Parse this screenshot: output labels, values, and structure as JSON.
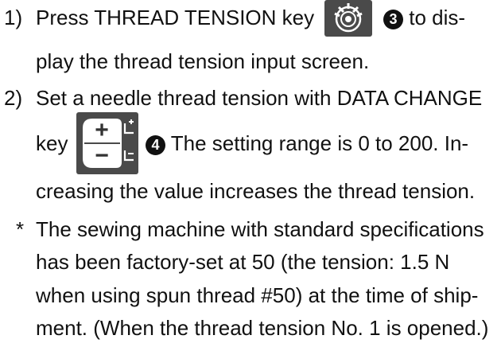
{
  "step1": {
    "number": "1)",
    "before_key": "Press THREAD TENSION key",
    "marker": "3",
    "after_key": " to dis-",
    "continuation": "play the thread tension input screen."
  },
  "step2": {
    "number": "2)",
    "line1": "Set a needle thread tension with DATA CHANGE",
    "before_key": "key",
    "marker": "4",
    "after_key": " The setting range is 0 to 200. In-",
    "continuation": "creasing the value increases the thread tension."
  },
  "note": {
    "asterisk": "*",
    "lines": [
      "The sewing machine with standard specifications",
      "has been factory-set at 50 (the tension: 1.5 N",
      "when using spun thread #50) at the time of ship-",
      "ment. (When the thread tension No. 1 is opened.)"
    ]
  },
  "keys": {
    "data_change_plus": "+",
    "data_change_minus": "−"
  }
}
